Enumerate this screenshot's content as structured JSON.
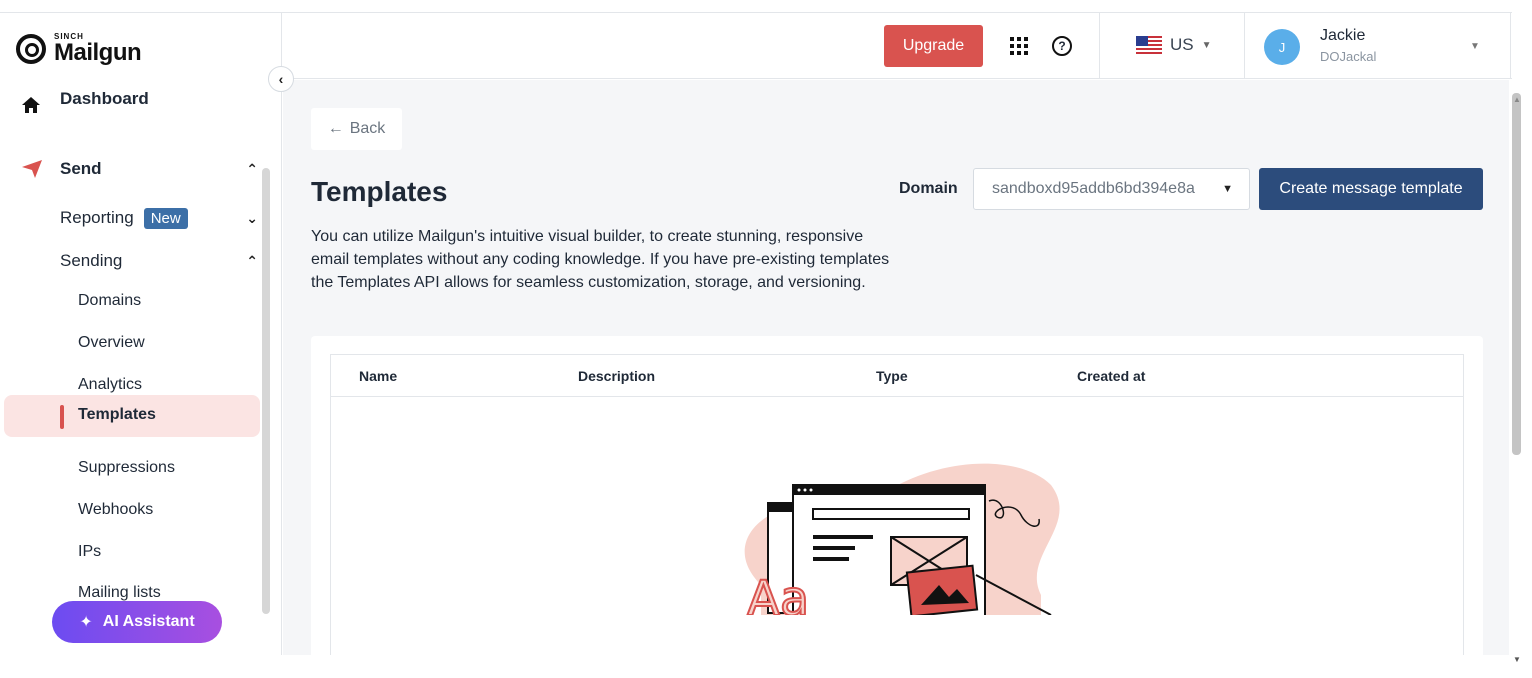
{
  "brand": {
    "sinch": "SINCH",
    "name": "Mailgun"
  },
  "topbar": {
    "upgrade_label": "Upgrade",
    "region": "US",
    "user": {
      "initial": "J",
      "name": "Jackie",
      "org": "DOJackal"
    }
  },
  "sidebar": {
    "items": [
      {
        "label": "Dashboard"
      },
      {
        "label": "Send"
      },
      {
        "label": "Reporting",
        "badge": "New"
      },
      {
        "label": "Sending"
      },
      {
        "label": "Domains"
      },
      {
        "label": "Overview"
      },
      {
        "label": "Analytics"
      },
      {
        "label": "Templates",
        "active": true
      },
      {
        "label": "Suppressions"
      },
      {
        "label": "Webhooks"
      },
      {
        "label": "IPs"
      },
      {
        "label": "Mailing lists"
      }
    ],
    "ai_assistant_label": "AI Assistant"
  },
  "main": {
    "back_label": "Back",
    "title": "Templates",
    "description": "You can utilize Mailgun's intuitive visual builder, to create stunning, responsive email templates without any coding knowledge. If you have pre-existing templates the Templates API allows for seamless customization, storage, and versioning.",
    "domain_label": "Domain",
    "domain_value": "sandboxd95addb6bd394e8a",
    "create_label": "Create message template",
    "table": {
      "columns": [
        "Name",
        "Description",
        "Type",
        "Created at"
      ]
    }
  },
  "colors": {
    "accent_red": "#d9534f",
    "primary_blue": "#2c4c7c",
    "badge_blue": "#3c6fa7",
    "active_bg": "#fbe4e3"
  }
}
